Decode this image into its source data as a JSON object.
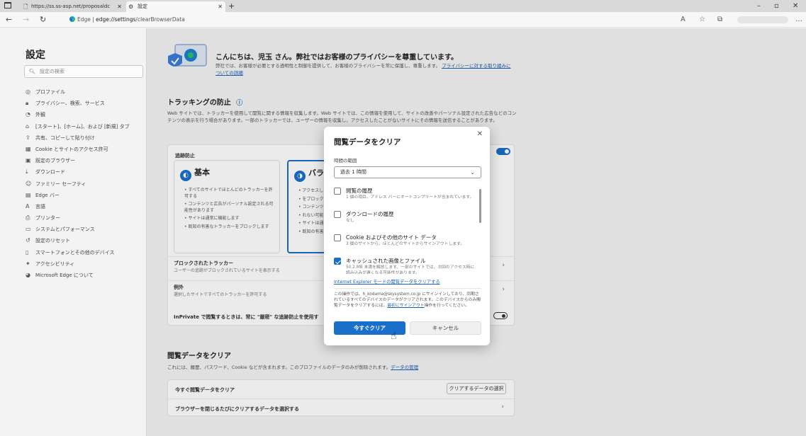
{
  "browser": {
    "tabs": [
      {
        "label": "https://ss.ss-asp.net/proposaldc",
        "active": false
      },
      {
        "label": "設定",
        "active": true
      }
    ],
    "address": {
      "prefix": "Edge",
      "url_host": "edge://settings",
      "url_path": "/clearBrowserData"
    }
  },
  "sidebar": {
    "title": "設定",
    "search_placeholder": "設定の検索",
    "items": [
      {
        "label": "プロファイル",
        "icon": "profile-icon"
      },
      {
        "label": "プライバシー、検索、サービス",
        "icon": "lock-icon"
      },
      {
        "label": "外観",
        "icon": "palette-icon"
      },
      {
        "label": "[スタート]、[ホーム]、および [新規] タブ",
        "icon": "home-icon"
      },
      {
        "label": "共有、コピーして貼り付け",
        "icon": "share-icon"
      },
      {
        "label": "Cookie とサイトのアクセス許可",
        "icon": "cookie-icon"
      },
      {
        "label": "既定のブラウザー",
        "icon": "browser-icon"
      },
      {
        "label": "ダウンロード",
        "icon": "download-icon"
      },
      {
        "label": "ファミリー セーフティ",
        "icon": "family-icon"
      },
      {
        "label": "Edge バー",
        "icon": "edge-bar-icon"
      },
      {
        "label": "言語",
        "icon": "language-icon"
      },
      {
        "label": "プリンター",
        "icon": "printer-icon"
      },
      {
        "label": "システムとパフォーマンス",
        "icon": "system-icon"
      },
      {
        "label": "設定のリセット",
        "icon": "reset-icon"
      },
      {
        "label": "スマートフォンとその他のデバイス",
        "icon": "phone-icon"
      },
      {
        "label": "アクセシビリティ",
        "icon": "accessibility-icon"
      },
      {
        "label": "Microsoft Edge について",
        "icon": "edge-icon"
      }
    ]
  },
  "hero": {
    "title": "こんにちは、児玉 さん。弊社ではお客様のプライバシーを尊重しています。",
    "desc": "弊社では、お客様が必要とする透明性と制御を提供して、お客様のプライバシーを常に保護し、尊重します。",
    "link": "プライバシーに対する取り組みについての詳細"
  },
  "tracking": {
    "title": "トラッキングの防止",
    "desc": "Web サイトでは、トラッカーを使用して閲覧に関する情報を収集します。Web サイトでは、この情報を使用して、サイトの改善やパーソナル設定された広告などのコンテンツの表示を行う場合があります。一部のトラッカーでは、ユーザーの情報を収集し、アクセスしたことがないサイトにその情報を送信することがあります。",
    "card_header": "追跡防止",
    "basic": {
      "title": "基本",
      "bullets": [
        "すべてのサイトでほとんどのトラッカーを許可する",
        "コンテンツと広告がパーソナル設定される可能性があります",
        "サイトは通常に機能します",
        "既知の有害なトラッカーをブロックします"
      ]
    },
    "balanced": {
      "title": "バラ",
      "bullets": [
        "アクセスした",
        "をブロックし",
        "コンテンツと",
        "れない可能",
        "サイトは通",
        "既知の有害"
      ]
    },
    "blocked_title": "ブロックされたトラッカー",
    "blocked_sub": "ユーザーの追跡がブロックされているサイトを表示する",
    "exceptions_title": "例外",
    "exceptions_sub": "選択したサイトですべてのトラッカーを許可する",
    "inprivate": "InPrivate で閲覧するときは、常に \"厳密\" な追跡防止を使用す"
  },
  "clear_section": {
    "title": "閲覧データをクリア",
    "desc": "これには、履歴、パスワード、Cookie などが含まれます。このプロファイルのデータのみが削除されます。",
    "manage_link": "データの管理",
    "row1": "今すぐ閲覧データをクリア",
    "row1_button": "クリアするデータの選択",
    "row2": "ブラウザーを閉じるたびにクリアするデータを選択する"
  },
  "dialog": {
    "title": "閲覧データをクリア",
    "close_icon": "close-icon",
    "range_label": "時間の範囲",
    "range_value": "過去 1 時間",
    "items": [
      {
        "title": "閲覧の履歴",
        "sub": "1 個の項目。アドレス バーにオートコンプリートが含まれています。",
        "checked": false
      },
      {
        "title": "ダウンロードの履歴",
        "sub": "なし",
        "checked": false
      },
      {
        "title": "Cookie およびその他のサイト データ",
        "sub": "3 個のサイトから。ほとんどのサイトからサインアウトします。",
        "checked": false
      },
      {
        "title": "キャッシュされた画像とファイル",
        "sub": "50.2 MB 未満を解放します。一部のサイトでは、次回のアクセス時に読み込みが遅くなる可能性があります。",
        "checked": true
      }
    ],
    "ie_link": "Internet Explorer モードの閲覧データをクリアする",
    "note": "この操作では、h_kodama@skysystem.co.jp にサインインしており、同期されているすべてのデバイスのデータがクリアされます。このデバイスからのみ閲覧データをクリアするには、",
    "note_link": "最初にサインアウト",
    "note_tail": "操作を行ってください。",
    "clear_button": "今すぐクリア",
    "cancel_button": "キャンセル"
  },
  "colors": {
    "accent": "#1a6fc9",
    "link": "#1a5fb4"
  }
}
